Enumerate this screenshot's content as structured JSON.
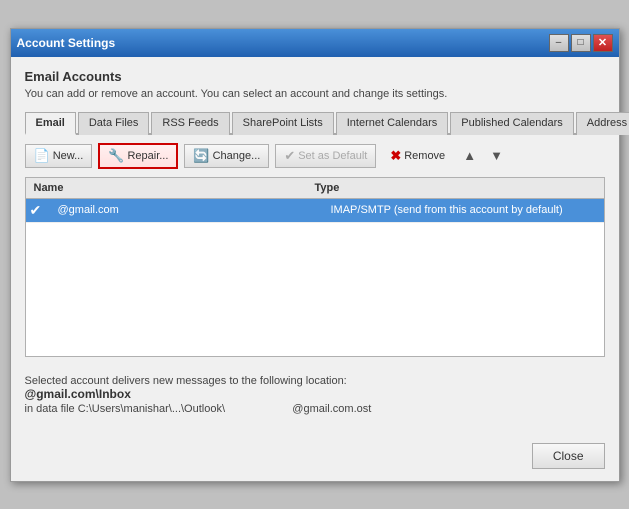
{
  "window": {
    "title": "Account Settings"
  },
  "header": {
    "section_title": "Email Accounts",
    "description": "You can add or remove an account. You can select an account and change its settings."
  },
  "tabs": [
    {
      "id": "email",
      "label": "Email",
      "active": true
    },
    {
      "id": "data-files",
      "label": "Data Files",
      "active": false
    },
    {
      "id": "rss-feeds",
      "label": "RSS Feeds",
      "active": false
    },
    {
      "id": "sharepoint-lists",
      "label": "SharePoint Lists",
      "active": false
    },
    {
      "id": "internet-calendars",
      "label": "Internet Calendars",
      "active": false
    },
    {
      "id": "published-calendars",
      "label": "Published Calendars",
      "active": false
    },
    {
      "id": "address-books",
      "label": "Address Books",
      "active": false
    }
  ],
  "toolbar": {
    "new_label": "New...",
    "repair_label": "Repair...",
    "change_label": "Change...",
    "set_default_label": "Set as Default",
    "remove_label": "Remove"
  },
  "table": {
    "columns": [
      "Name",
      "Type"
    ],
    "rows": [
      {
        "checked": true,
        "name": "@gmail.com",
        "type": "IMAP/SMTP (send from this account by default)",
        "selected": true
      }
    ]
  },
  "footer": {
    "info_text": "Selected account delivers new messages to the following location:",
    "location_bold": "@gmail.com\\Inbox",
    "path_text": "in data file C:\\Users\\manishar\\...\\Outlook\\",
    "ost_text": "@gmail.com.ost"
  },
  "buttons": {
    "close_label": "Close"
  },
  "icons": {
    "new": "📄",
    "repair": "🔧",
    "change": "🔄",
    "set_default": "✔",
    "remove": "✖",
    "check": "✔",
    "arrow_up": "▲",
    "arrow_down": "▼"
  }
}
